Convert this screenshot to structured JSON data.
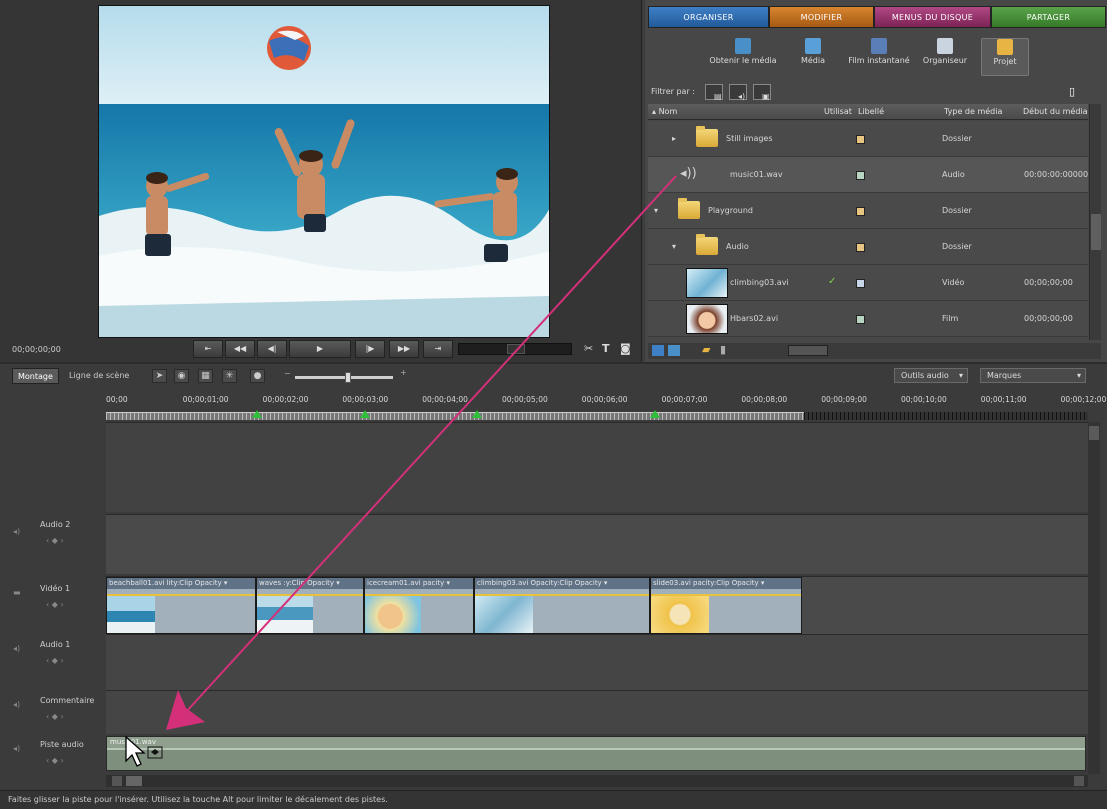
{
  "monitor": {
    "timecode": "00;00;00;00",
    "controls": [
      "step-back",
      "rewind",
      "frame-back",
      "play",
      "frame-forward",
      "fast-forward",
      "step-forward"
    ],
    "right_icons": [
      "scissors-icon",
      "text-icon",
      "camera-icon"
    ]
  },
  "tabs": {
    "organiser": "ORGANISER",
    "modifier": "MODIFIER",
    "menus": "MENUS DU DISQUE",
    "partager": "PARTAGER"
  },
  "toolbar": {
    "obtenir": "Obtenir le média",
    "media": "Média",
    "film": "Film instantané",
    "organiseur": "Organiseur",
    "projet": "Projet"
  },
  "filter": {
    "label": "Filtrer par :"
  },
  "columns": {
    "nom": "Nom",
    "utilise": "Utilisat",
    "libelle": "Libellé",
    "type": "Type de média",
    "debut": "Début du média"
  },
  "rows": [
    {
      "name": "Still images",
      "type": "Dossier",
      "debut": "",
      "used": "",
      "swatch": "#e8c583",
      "kind": "folder",
      "indent": 1,
      "expander": "▸"
    },
    {
      "name": "music01.wav",
      "type": "Audio",
      "debut": "00:00:00:00000",
      "used": "",
      "swatch": "#b9d4c0",
      "kind": "audio",
      "indent": 1,
      "expander": ""
    },
    {
      "name": "Playground",
      "type": "Dossier",
      "debut": "",
      "used": "",
      "swatch": "#e8c583",
      "kind": "folder",
      "indent": 0,
      "expander": "▾"
    },
    {
      "name": "Audio",
      "type": "Dossier",
      "debut": "",
      "used": "",
      "swatch": "#e8c583",
      "kind": "folder",
      "indent": 1,
      "expander": "▾"
    },
    {
      "name": "climbing03.avi",
      "type": "Vidéo",
      "debut": "00;00;00;00",
      "used": "✓",
      "swatch": "#c8d6ea",
      "kind": "video",
      "indent": 1,
      "expander": ""
    },
    {
      "name": "Hbars02.avi",
      "type": "Film",
      "debut": "00;00;00;00",
      "used": "",
      "swatch": "#b9d4c0",
      "kind": "film",
      "indent": 1,
      "expander": ""
    }
  ],
  "timeline": {
    "tab_montage": "Montage",
    "tab_scene": "Ligne de scène",
    "outils_audio": "Outils audio",
    "marques": "Marques",
    "ticks": [
      "00;00",
      "00;00;01;00",
      "00;00;02;00",
      "00;00;03;00",
      "00;00;04;00",
      "00;00;05;00",
      "00;00;06;00",
      "00;00;07;00",
      "00;00;08;00",
      "00;00;09;00",
      "00;00;10;00",
      "00;00;11;00",
      "00;00;12;00"
    ],
    "tracks": {
      "audio2": "Audio 2",
      "video1": "Vidéo 1",
      "audio1": "Audio 1",
      "commentaire": "Commentaire",
      "piste_audio": "Piste audio"
    },
    "clips": [
      {
        "label": "beachball01.avi  lity:Clip Opacity ▾"
      },
      {
        "label": "waves  :y:Clip Opacity ▾"
      },
      {
        "label": "icecream01.avi  pacity ▾"
      },
      {
        "label": "climbing03.avi  Opacity:Clip Opacity ▾"
      },
      {
        "label": "slide03.avi  pacity:Clip Opacity ▾"
      }
    ],
    "audio_clip": "music01.wav"
  },
  "status": "Faites glisser la piste pour l'insérer. Utilisez la touche Alt pour limiter le décalement des pistes."
}
